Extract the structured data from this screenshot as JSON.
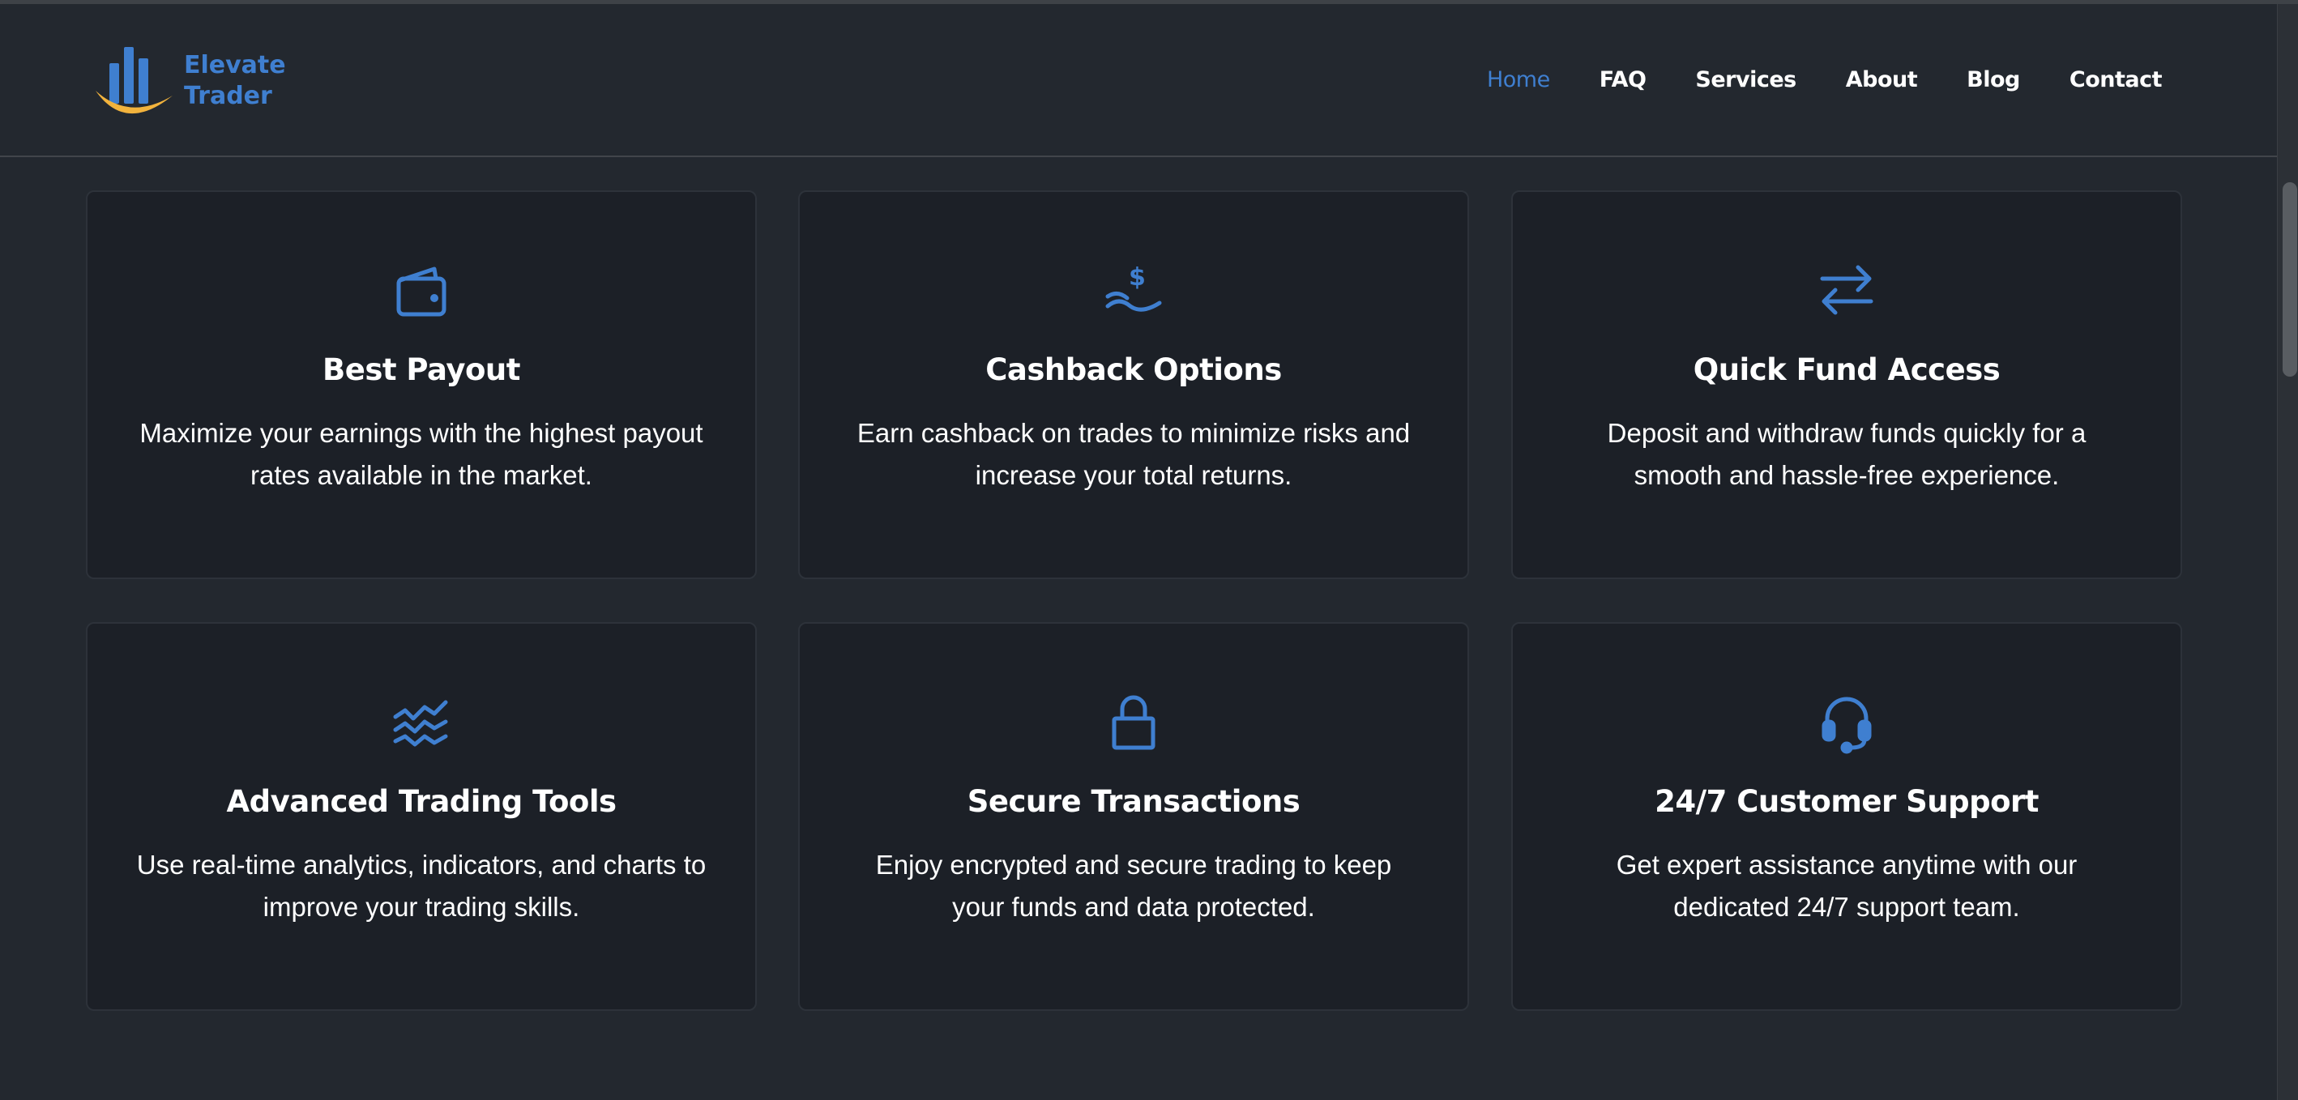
{
  "brand": {
    "line1": "Elevate",
    "line2": "Trader",
    "accent": "#3f7fd0",
    "smile": "#f2b33d"
  },
  "nav": [
    {
      "label": "Home",
      "active": true
    },
    {
      "label": "FAQ"
    },
    {
      "label": "Services"
    },
    {
      "label": "About"
    },
    {
      "label": "Blog"
    },
    {
      "label": "Contact"
    }
  ],
  "features": [
    {
      "icon": "wallet-icon",
      "title": "Best Payout",
      "description": "Maximize your earnings with the highest payout rates available in the market."
    },
    {
      "icon": "cashback-hand-dollar-icon",
      "title": "Cashback Options",
      "description": "Earn cashback on trades to minimize risks and increase your total returns."
    },
    {
      "icon": "transfer-arrows-icon",
      "title": "Quick Fund Access",
      "description": "Deposit and withdraw funds quickly for a smooth and hassle-free experience."
    },
    {
      "icon": "trading-lines-icon",
      "title": "Advanced Trading Tools",
      "description": "Use real-time analytics, indicators, and charts to improve your trading skills."
    },
    {
      "icon": "lock-icon",
      "title": "Secure Transactions",
      "description": "Enjoy encrypted and secure trading to keep your funds and data protected."
    },
    {
      "icon": "headset-icon",
      "title": "24/7 Customer Support",
      "description": "Get expert assistance anytime with our dedicated 24/7 support team."
    }
  ]
}
